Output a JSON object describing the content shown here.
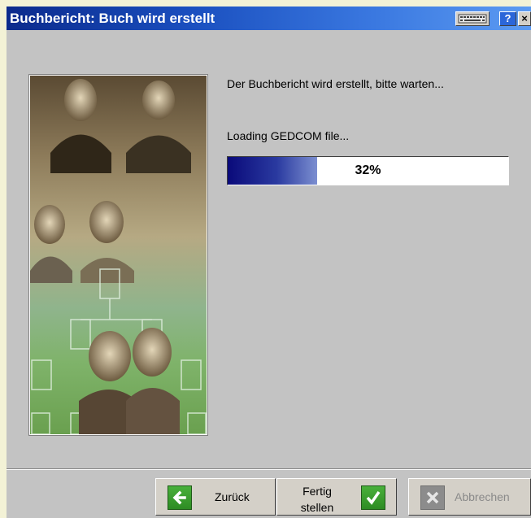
{
  "window": {
    "title": "Buchbericht: Buch wird erstellt",
    "help_symbol": "?",
    "close_symbol": "×"
  },
  "main": {
    "message": "Der Buchbericht wird erstellt, bitte warten...",
    "status": "Loading GEDCOM file...",
    "progress_percent": 32,
    "progress_label": "32%"
  },
  "buttons": {
    "back_label": "Zurück",
    "back_icon": "arrow-left-icon",
    "finish_label_line1": "Fertig",
    "finish_label_line2": "stellen",
    "finish_icon": "checkmark-icon",
    "cancel_label": "Abbrechen",
    "cancel_icon": "x-icon"
  },
  "colors": {
    "titlebar": "#0b2a8c",
    "progress_fill": "#0a0a7a",
    "button_icon_green": "#3a9e2e"
  }
}
